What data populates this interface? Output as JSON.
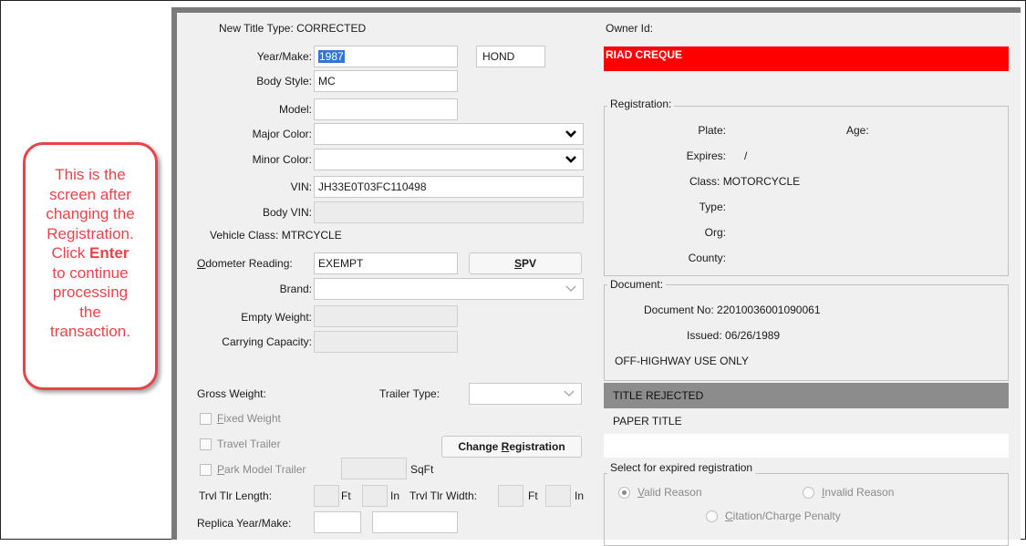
{
  "callout": {
    "line1": "This is the",
    "line2": "screen after",
    "line3": "changing the",
    "line4": "Registration.",
    "line5_pre": "Click ",
    "line5_bold": "Enter",
    "line6": "to continue",
    "line7": "processing",
    "line8": "the",
    "line9": "transaction."
  },
  "form": {
    "new_title_type_label": "New Title Type:",
    "new_title_type_value": "CORRECTED",
    "year_make_label": "Year/Make:",
    "year_value": "1987",
    "make_value": "HOND",
    "body_style_label": "Body Style:",
    "body_style_value": "MC",
    "model_label": "Model:",
    "model_value": "",
    "major_color_label": "Major Color:",
    "major_color_value": "",
    "minor_color_label": "Minor Color:",
    "minor_color_value": "",
    "vin_label": "VIN:",
    "vin_value": "JH33E0T03FC110498",
    "body_vin_label": "Body VIN:",
    "body_vin_value": "",
    "vehicle_class_label": "Vehicle Class:",
    "vehicle_class_value": "MTRCYCLE",
    "odometer_label_u": "O",
    "odometer_label_rest": "dometer Reading:",
    "odometer_value": "EXEMPT",
    "spv_label_u": "S",
    "spv_label_rest": "PV",
    "brand_label": "Brand:",
    "brand_value": "",
    "empty_weight_label": "Empty Weight:",
    "carrying_capacity_label": "Carrying Capacity:",
    "gross_weight_label": "Gross Weight:",
    "trailer_type_label": "Trailer Type:",
    "fixed_weight_u": "F",
    "fixed_weight_rest": "ixed Weight",
    "travel_trailer_label": "Travel Trailer",
    "change_reg_pre": "Change ",
    "change_reg_u": "R",
    "change_reg_rest": "egistration",
    "park_model_u": "P",
    "park_model_rest": "ark Model Trailer",
    "sqft_label": "SqFt",
    "trvl_len_label": "Trvl Tlr Length:",
    "ft_label": "Ft",
    "in_label": "In",
    "trvl_width_label": "Trvl Tlr Width:",
    "replica_label": "Replica Year/Make:"
  },
  "owner": {
    "owner_id_label": "Owner Id:",
    "owner_name": "RIAD CREQUE"
  },
  "registration": {
    "title": "Registration:",
    "plate_label": "Plate:",
    "age_label": "Age:",
    "expires_label": "Expires:",
    "expires_value": "/",
    "class_label": "Class:",
    "class_value": "MOTORCYCLE",
    "type_label": "Type:",
    "org_label": "Org:",
    "county_label": "County:"
  },
  "document": {
    "title": "Document:",
    "doc_no_label": "Document No:",
    "doc_no_value": "22010036001090061",
    "issued_label": "Issued:",
    "issued_value": "06/26/1989",
    "remark": "OFF-HIGHWAY USE ONLY"
  },
  "status_list": {
    "items": [
      "TITLE REJECTED",
      "PAPER TITLE"
    ]
  },
  "expired": {
    "title": "Select for expired registration",
    "valid_u": "V",
    "valid_rest": "alid Reason",
    "invalid_u": "I",
    "invalid_rest": "nvalid Reason",
    "citation_u": "C",
    "citation_rest": "itation/Charge Penalty"
  },
  "colors": {
    "owner_bar": "#ff0000",
    "callout_border": "#e8434a",
    "selected_row": "#8c8c8c",
    "app_bg": "#f0f0f0"
  }
}
